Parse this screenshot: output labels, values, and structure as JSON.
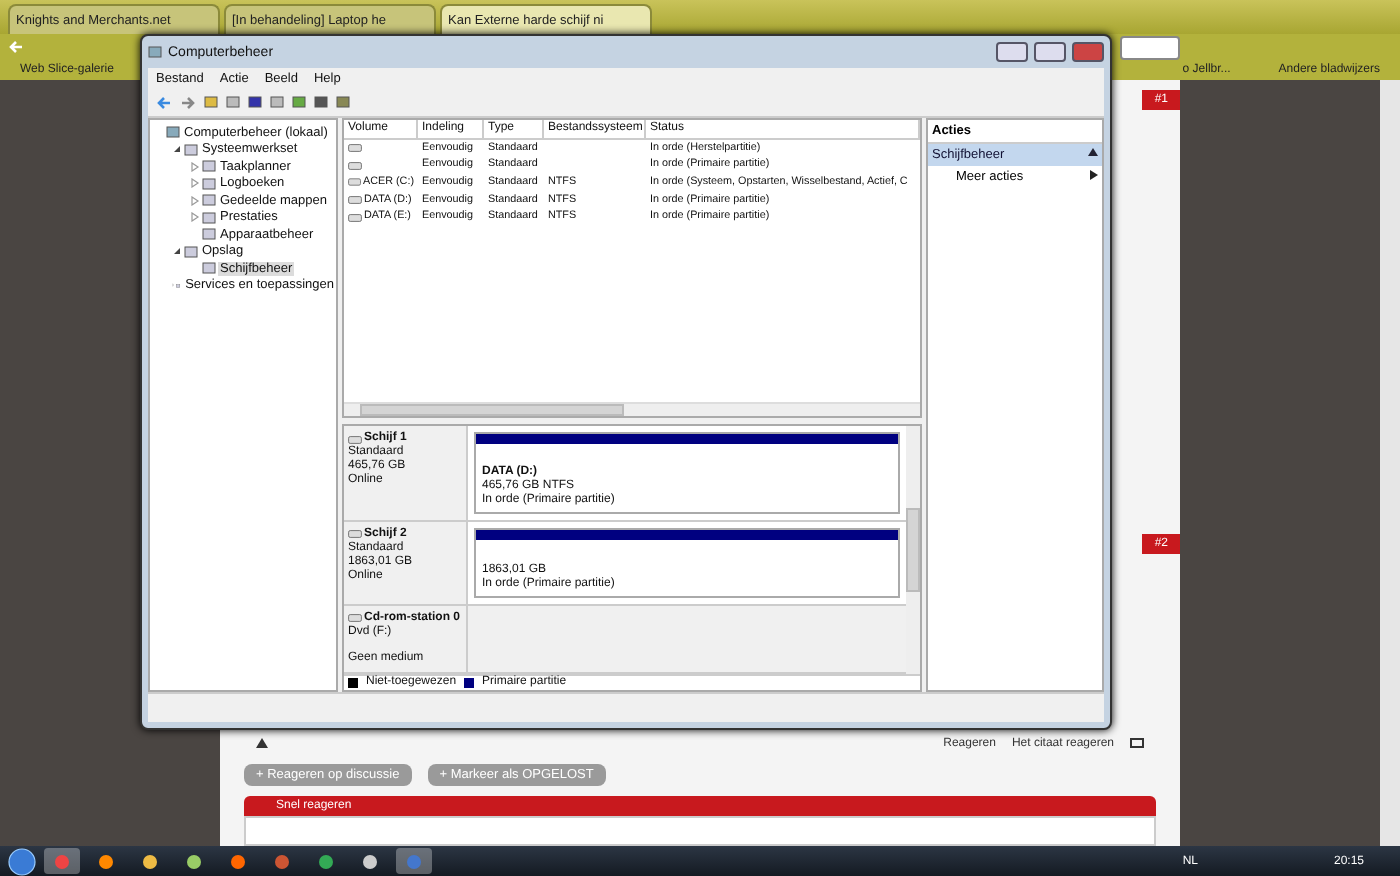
{
  "browser": {
    "tabs": [
      {
        "label": "Knights and Merchants.net",
        "selected": false
      },
      {
        "label": "[In behandeling] Laptop he",
        "selected": false
      },
      {
        "label": "Kan Externe harde schijf ni",
        "selected": true
      }
    ],
    "bookmarks": [
      "Web Slice-galerie",
      "o Jellbr..."
    ],
    "other_bookmarks": "Andere bladwijzers"
  },
  "forum": {
    "badges": [
      "#1",
      "#2"
    ],
    "post_actions": [
      "Reageren",
      "Het citaat reageren"
    ],
    "buttons": [
      "+ Reageren op discussie",
      "+ Markeer als OPGELOST"
    ],
    "quick_reply": "Snel reageren"
  },
  "window": {
    "title": "Computerbeheer",
    "menu": [
      "Bestand",
      "Actie",
      "Beeld",
      "Help"
    ],
    "tree": [
      {
        "label": "Computerbeheer (lokaal)",
        "selected": false,
        "children": [
          {
            "label": "Systeemwerkset",
            "selected": false,
            "expanded": true,
            "children": [
              {
                "label": "Taakplanner",
                "selected": false,
                "expanded": false
              },
              {
                "label": "Logboeken",
                "selected": false,
                "expanded": false
              },
              {
                "label": "Gedeelde mappen",
                "selected": false,
                "expanded": false
              },
              {
                "label": "Prestaties",
                "selected": false,
                "expanded": false
              },
              {
                "label": "Apparaatbeheer",
                "selected": false
              }
            ]
          },
          {
            "label": "Opslag",
            "selected": false,
            "expanded": true,
            "children": [
              {
                "label": "Schijfbeheer",
                "selected": true
              }
            ]
          },
          {
            "label": "Services en toepassingen",
            "selected": false,
            "expanded": false
          }
        ]
      }
    ],
    "table": {
      "columns": [
        "Volume",
        "Indeling",
        "Type",
        "Bestandssysteem",
        "Status"
      ],
      "rows": [
        [
          "",
          "Eenvoudig",
          "Standaard",
          "",
          "In orde (Herstelpartitie)"
        ],
        [
          "",
          "Eenvoudig",
          "Standaard",
          "",
          "In orde (Primaire partitie)"
        ],
        [
          "ACER (C:)",
          "Eenvoudig",
          "Standaard",
          "NTFS",
          "In orde (Systeem, Opstarten, Wisselbestand, Actief, C"
        ],
        [
          "DATA (D:)",
          "Eenvoudig",
          "Standaard",
          "NTFS",
          "In orde (Primaire partitie)"
        ],
        [
          "DATA (E:)",
          "Eenvoudig",
          "Standaard",
          "NTFS",
          "In orde (Primaire partitie)"
        ]
      ]
    },
    "disks": [
      {
        "kind": "disk",
        "name": "Schijf 1",
        "lines": [
          "Standaard",
          "465,76 GB",
          "Online"
        ],
        "partition": {
          "title": "DATA  (D:)",
          "lines": [
            "465,76 GB NTFS",
            "In orde (Primaire partitie)"
          ]
        }
      },
      {
        "kind": "disk",
        "name": "Schijf 2",
        "lines": [
          "Standaard",
          "1863,01 GB",
          "Online"
        ],
        "partition": {
          "lines": [
            "1863,01 GB",
            "In orde (Primaire partitie)"
          ]
        }
      },
      {
        "kind": "cdrom",
        "name": "Cd-rom-station 0",
        "lines": [
          "Dvd (F:)"
        ],
        "footer": "Geen medium"
      }
    ],
    "legend": [
      {
        "label": "Niet-toegewezen",
        "color": "#000000"
      },
      {
        "label": "Primaire partitie",
        "color": "#000080"
      }
    ],
    "actions": {
      "header": "Acties",
      "section": "Schijfbeheer",
      "items": [
        "Meer acties"
      ]
    }
  },
  "taskbar": {
    "apps": [
      {
        "kind": "chrome",
        "selected": true
      },
      {
        "kind": "firefox",
        "selected": false
      },
      {
        "kind": "folder",
        "selected": false
      },
      {
        "kind": "notes",
        "selected": false
      },
      {
        "kind": "power",
        "selected": false
      },
      {
        "kind": "game",
        "selected": false
      },
      {
        "kind": "vpn",
        "selected": false
      },
      {
        "kind": "steam",
        "selected": false
      },
      {
        "kind": "computer",
        "selected": true
      }
    ],
    "language": "NL",
    "clock": "20:15"
  }
}
